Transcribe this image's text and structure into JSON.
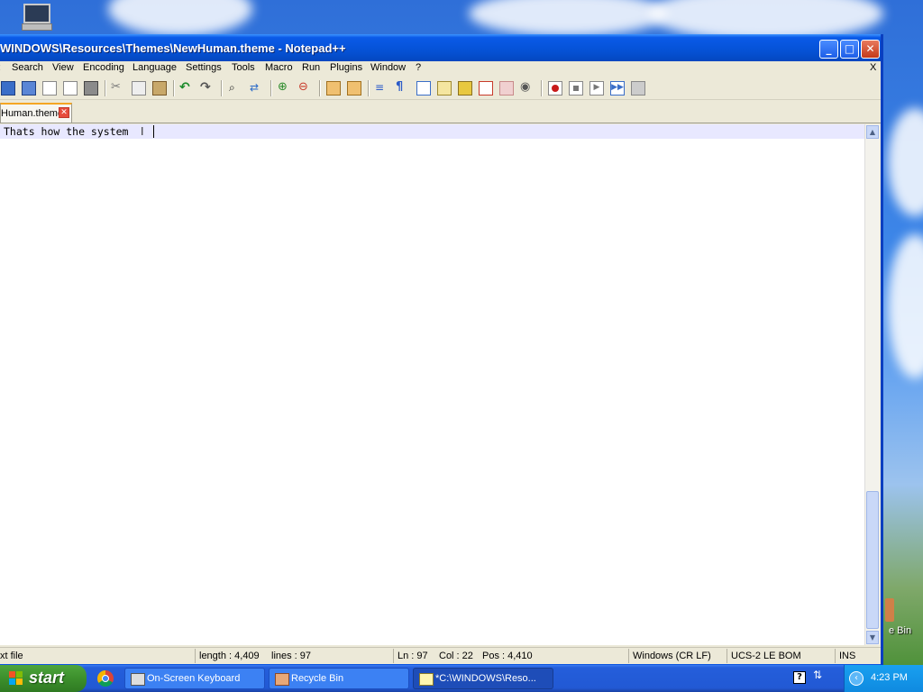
{
  "window": {
    "title": "WINDOWS\\Resources\\Themes\\NewHuman.theme - Notepad++",
    "btn_min": "_",
    "btn_max": "□",
    "btn_close": "✕"
  },
  "menu": {
    "items": [
      "Search",
      "View",
      "Encoding",
      "Language",
      "Settings",
      "Tools",
      "Macro",
      "Run",
      "Plugins",
      "Window",
      "?"
    ],
    "close": "X"
  },
  "tabs": {
    "active_label": "Human.theme",
    "close_glyph": "✕"
  },
  "editor": {
    "line_text": "Thats how the system"
  },
  "status": {
    "type": "xt file",
    "length": "length : 4,409",
    "lines": "lines : 97",
    "ln": "Ln : 97",
    "col": "Col : 22",
    "pos": "Pos : 4,410",
    "eol": "Windows (CR LF)",
    "encoding": "UCS-2 LE BOM",
    "mode": "INS"
  },
  "desktop": {
    "recycle_label": "e Bin"
  },
  "taskbar": {
    "start_label": "start",
    "tasks": [
      {
        "label": "On-Screen Keyboard"
      },
      {
        "label": "Recycle Bin"
      },
      {
        "label": "*C:\\WINDOWS\\Reso..."
      }
    ],
    "help": "?",
    "clock": "4:23 PM"
  },
  "colors": {
    "titlebar": "#0552d6",
    "taskbar": "#245edb",
    "start": "#3c8f2c",
    "current_line": "#e8e8ff"
  }
}
